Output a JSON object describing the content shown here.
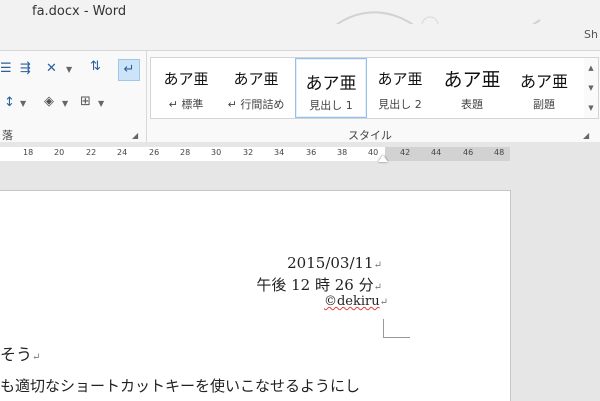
{
  "window": {
    "title": "fa.docx - Word",
    "tab_right_fragment": "Sh"
  },
  "ribbon": {
    "paragraph_group_label": "落",
    "styles_group_label": "スタイル",
    "styles": [
      {
        "preview": "あア亜",
        "name": "↵ 標準",
        "selected": false
      },
      {
        "preview": "あア亜",
        "name": "↵ 行間詰め",
        "selected": false
      },
      {
        "preview": "あア亜",
        "name": "見出し 1",
        "selected": true
      },
      {
        "preview": "あア亜",
        "name": "見出し 2",
        "selected": false
      },
      {
        "preview": "あア亜",
        "name": "表題",
        "selected": false
      },
      {
        "preview": "あア亜",
        "name": "副題",
        "selected": false
      }
    ]
  },
  "ruler": {
    "ticks": [
      "18",
      "20",
      "22",
      "24",
      "26",
      "28",
      "30",
      "32",
      "34",
      "36",
      "38",
      "40",
      "42",
      "44",
      "46",
      "48"
    ]
  },
  "document": {
    "date": "2015/03/11",
    "time": "午後 12 時 26 分",
    "copyright": "©dekiru",
    "para_mark": "↵",
    "line1": "そう",
    "line2": "も適切なショートカットキーを使いこなせるようにし"
  },
  "colors": {
    "accent": "#2a5ea0",
    "selected_border": "#97c1ea"
  }
}
